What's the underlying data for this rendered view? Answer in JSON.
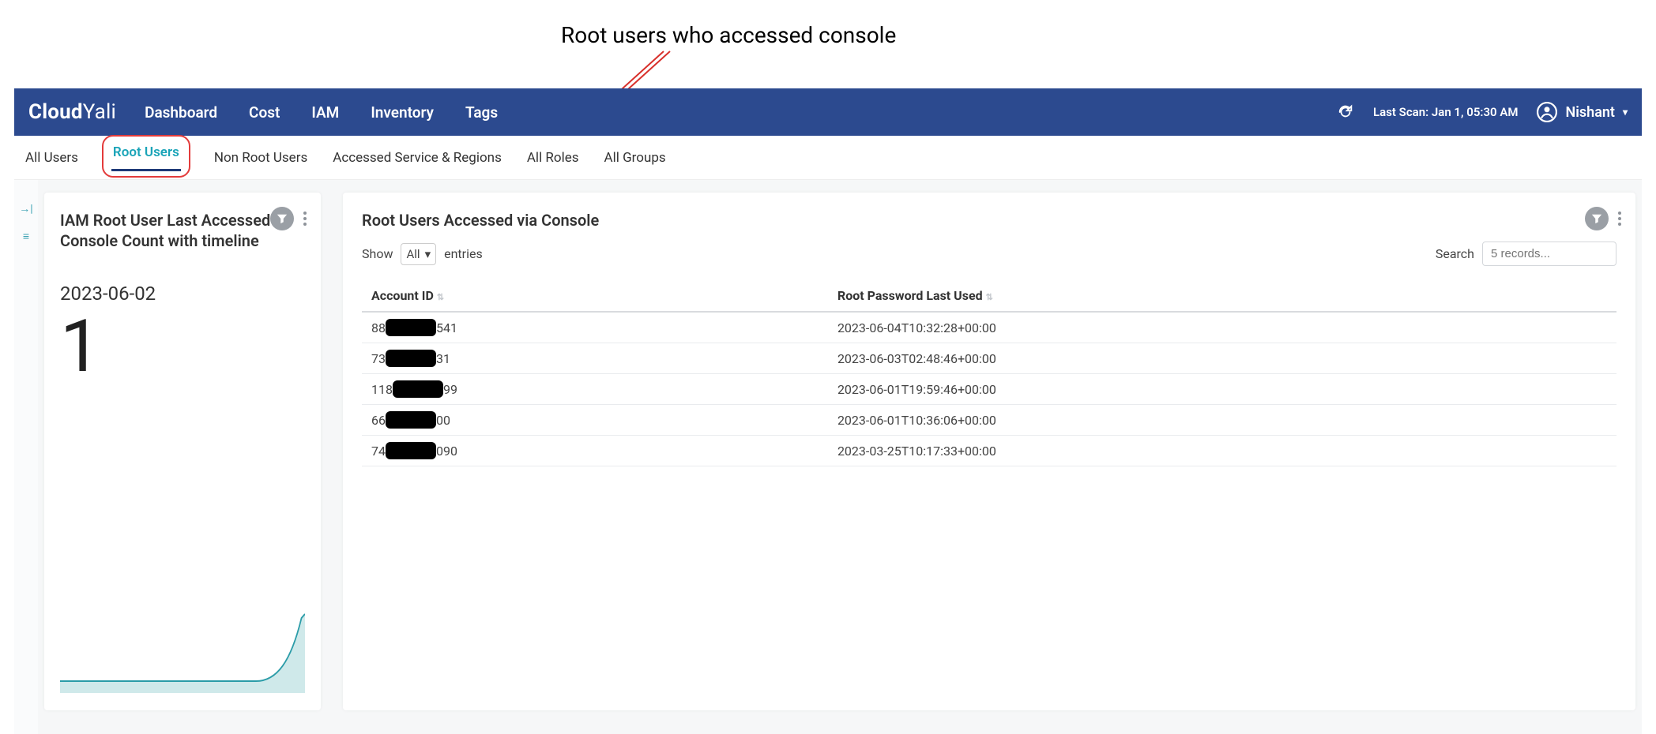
{
  "annotations": {
    "top": "Root users who accessed console",
    "right_line1": "Root password",
    "right_line2": "Last used"
  },
  "brand": {
    "part1": "Cloud",
    "part2": "Yali"
  },
  "nav": {
    "dashboard": "Dashboard",
    "cost": "Cost",
    "iam": "IAM",
    "inventory": "Inventory",
    "tags": "Tags"
  },
  "topright": {
    "lastscan": "Last Scan: Jan 1, 05:30 AM",
    "user": "Nishant"
  },
  "subtabs": {
    "all_users": "All Users",
    "root_users": "Root Users",
    "non_root_users": "Non Root Users",
    "accessed": "Accessed Service & Regions",
    "all_roles": "All Roles",
    "all_groups": "All Groups"
  },
  "left_card": {
    "title": "IAM Root User Last Accessed Console Count with timeline",
    "date": "2023-06-02",
    "value": "1"
  },
  "right_card": {
    "title": "Root Users Accessed via Console",
    "show_label": "Show",
    "show_value": "All",
    "entries_label": "entries",
    "search_label": "Search",
    "search_placeholder": "5 records...",
    "headers": {
      "account": "Account ID",
      "lastused": "Root Password Last Used"
    },
    "rows": [
      {
        "acc_pre": "88",
        "acc_post": "541",
        "ts": "2023-06-04T10:32:28+00:00"
      },
      {
        "acc_pre": "73",
        "acc_post": "31",
        "ts": "2023-06-03T02:48:46+00:00"
      },
      {
        "acc_pre": "118",
        "acc_post": "99",
        "ts": "2023-06-01T19:59:46+00:00"
      },
      {
        "acc_pre": "66",
        "acc_post": "00",
        "ts": "2023-06-01T10:36:06+00:00"
      },
      {
        "acc_pre": "74",
        "acc_post": "090",
        "ts": "2023-03-25T10:17:33+00:00"
      }
    ]
  },
  "chart_data": {
    "type": "area",
    "title": "IAM Root User Last Accessed Console Count with timeline",
    "xlabel": "",
    "ylabel": "",
    "ylim": [
      0,
      1.2
    ],
    "note": "x-axis unlabeled; last point corresponds to date shown",
    "series": [
      {
        "name": "count",
        "values": [
          0,
          0,
          0,
          0,
          0,
          0,
          0,
          0,
          0,
          0,
          0,
          0,
          0,
          0,
          0,
          0,
          0,
          0,
          0,
          1
        ]
      }
    ],
    "highlight": {
      "date": "2023-06-02",
      "value": 1
    }
  }
}
